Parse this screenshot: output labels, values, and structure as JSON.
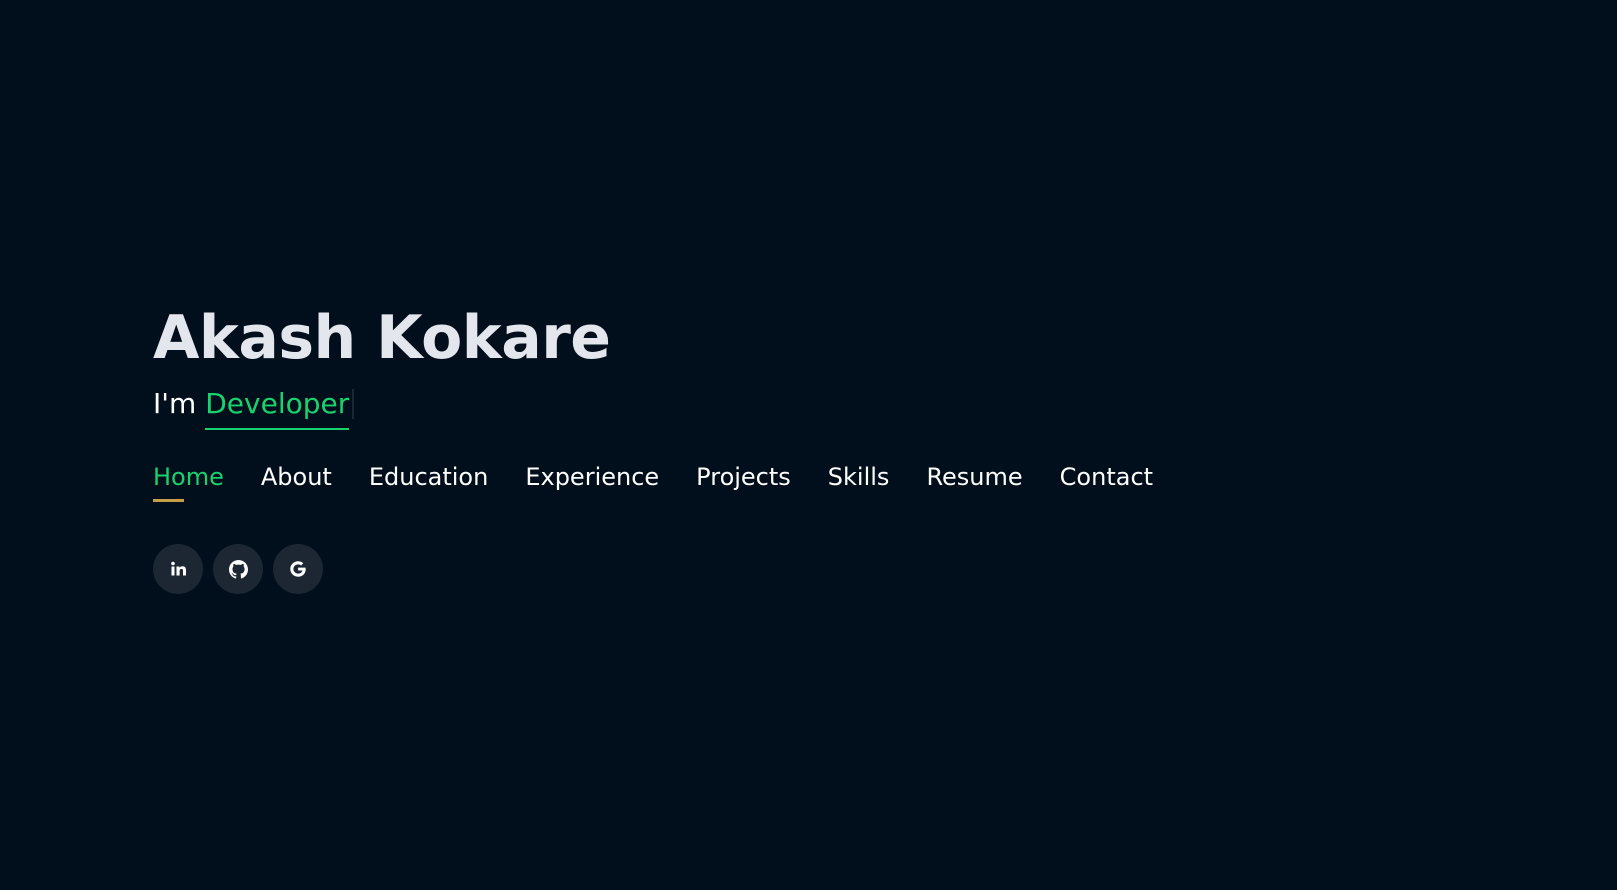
{
  "hero": {
    "name": "Akash Kokare",
    "tagline_prefix": "I'm",
    "tagline_role": "Developer"
  },
  "nav": {
    "items": [
      {
        "label": "Home",
        "active": true
      },
      {
        "label": "About"
      },
      {
        "label": "Education"
      },
      {
        "label": "Experience"
      },
      {
        "label": "Projects"
      },
      {
        "label": "Skills"
      },
      {
        "label": "Resume"
      },
      {
        "label": "Contact"
      }
    ]
  },
  "social": {
    "icons": [
      "linkedin-icon",
      "github-icon",
      "google-icon"
    ]
  },
  "colors": {
    "background": "#010e1b",
    "accent": "#18d26e",
    "nav_indicator": "#c3a047",
    "social_bg": "#1d2733",
    "name_text": "#e3e6ec"
  }
}
